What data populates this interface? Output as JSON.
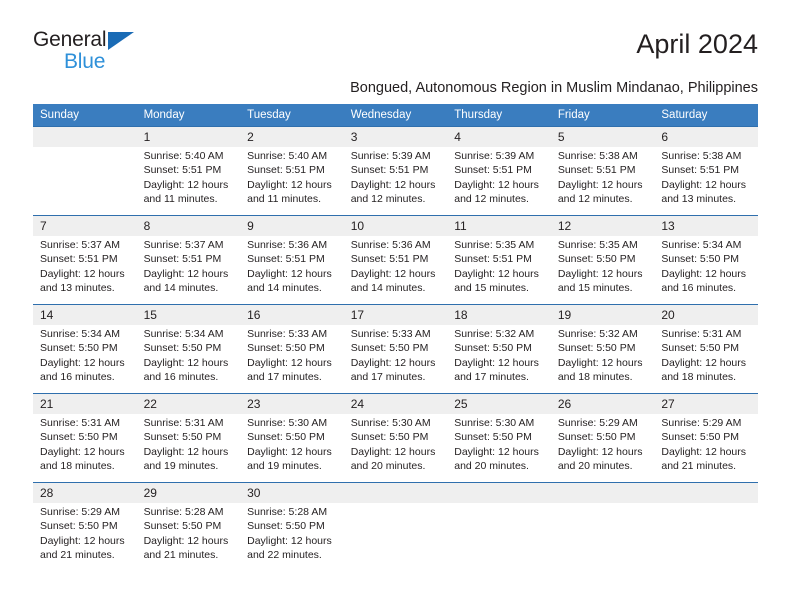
{
  "brand": {
    "name_part1": "General",
    "name_part2": "Blue",
    "triangle_color": "#1a6bb5",
    "blue_color": "#2e90d9"
  },
  "header": {
    "month_title": "April 2024",
    "location": "Bongued, Autonomous Region in Muslim Mindanao, Philippines"
  },
  "theme": {
    "header_bg": "#3a7dbf",
    "row_rule": "#2f6fad",
    "daynum_bg": "#efefef",
    "text": "#231f20"
  },
  "calendar": {
    "weekday_headers": [
      "Sunday",
      "Monday",
      "Tuesday",
      "Wednesday",
      "Thursday",
      "Friday",
      "Saturday"
    ],
    "weeks": [
      [
        {
          "day": "",
          "sunrise": "",
          "sunset": "",
          "daylight_line1": "",
          "daylight_line2": ""
        },
        {
          "day": "1",
          "sunrise": "Sunrise: 5:40 AM",
          "sunset": "Sunset: 5:51 PM",
          "daylight_line1": "Daylight: 12 hours",
          "daylight_line2": "and 11 minutes."
        },
        {
          "day": "2",
          "sunrise": "Sunrise: 5:40 AM",
          "sunset": "Sunset: 5:51 PM",
          "daylight_line1": "Daylight: 12 hours",
          "daylight_line2": "and 11 minutes."
        },
        {
          "day": "3",
          "sunrise": "Sunrise: 5:39 AM",
          "sunset": "Sunset: 5:51 PM",
          "daylight_line1": "Daylight: 12 hours",
          "daylight_line2": "and 12 minutes."
        },
        {
          "day": "4",
          "sunrise": "Sunrise: 5:39 AM",
          "sunset": "Sunset: 5:51 PM",
          "daylight_line1": "Daylight: 12 hours",
          "daylight_line2": "and 12 minutes."
        },
        {
          "day": "5",
          "sunrise": "Sunrise: 5:38 AM",
          "sunset": "Sunset: 5:51 PM",
          "daylight_line1": "Daylight: 12 hours",
          "daylight_line2": "and 12 minutes."
        },
        {
          "day": "6",
          "sunrise": "Sunrise: 5:38 AM",
          "sunset": "Sunset: 5:51 PM",
          "daylight_line1": "Daylight: 12 hours",
          "daylight_line2": "and 13 minutes."
        }
      ],
      [
        {
          "day": "7",
          "sunrise": "Sunrise: 5:37 AM",
          "sunset": "Sunset: 5:51 PM",
          "daylight_line1": "Daylight: 12 hours",
          "daylight_line2": "and 13 minutes."
        },
        {
          "day": "8",
          "sunrise": "Sunrise: 5:37 AM",
          "sunset": "Sunset: 5:51 PM",
          "daylight_line1": "Daylight: 12 hours",
          "daylight_line2": "and 14 minutes."
        },
        {
          "day": "9",
          "sunrise": "Sunrise: 5:36 AM",
          "sunset": "Sunset: 5:51 PM",
          "daylight_line1": "Daylight: 12 hours",
          "daylight_line2": "and 14 minutes."
        },
        {
          "day": "10",
          "sunrise": "Sunrise: 5:36 AM",
          "sunset": "Sunset: 5:51 PM",
          "daylight_line1": "Daylight: 12 hours",
          "daylight_line2": "and 14 minutes."
        },
        {
          "day": "11",
          "sunrise": "Sunrise: 5:35 AM",
          "sunset": "Sunset: 5:51 PM",
          "daylight_line1": "Daylight: 12 hours",
          "daylight_line2": "and 15 minutes."
        },
        {
          "day": "12",
          "sunrise": "Sunrise: 5:35 AM",
          "sunset": "Sunset: 5:50 PM",
          "daylight_line1": "Daylight: 12 hours",
          "daylight_line2": "and 15 minutes."
        },
        {
          "day": "13",
          "sunrise": "Sunrise: 5:34 AM",
          "sunset": "Sunset: 5:50 PM",
          "daylight_line1": "Daylight: 12 hours",
          "daylight_line2": "and 16 minutes."
        }
      ],
      [
        {
          "day": "14",
          "sunrise": "Sunrise: 5:34 AM",
          "sunset": "Sunset: 5:50 PM",
          "daylight_line1": "Daylight: 12 hours",
          "daylight_line2": "and 16 minutes."
        },
        {
          "day": "15",
          "sunrise": "Sunrise: 5:34 AM",
          "sunset": "Sunset: 5:50 PM",
          "daylight_line1": "Daylight: 12 hours",
          "daylight_line2": "and 16 minutes."
        },
        {
          "day": "16",
          "sunrise": "Sunrise: 5:33 AM",
          "sunset": "Sunset: 5:50 PM",
          "daylight_line1": "Daylight: 12 hours",
          "daylight_line2": "and 17 minutes."
        },
        {
          "day": "17",
          "sunrise": "Sunrise: 5:33 AM",
          "sunset": "Sunset: 5:50 PM",
          "daylight_line1": "Daylight: 12 hours",
          "daylight_line2": "and 17 minutes."
        },
        {
          "day": "18",
          "sunrise": "Sunrise: 5:32 AM",
          "sunset": "Sunset: 5:50 PM",
          "daylight_line1": "Daylight: 12 hours",
          "daylight_line2": "and 17 minutes."
        },
        {
          "day": "19",
          "sunrise": "Sunrise: 5:32 AM",
          "sunset": "Sunset: 5:50 PM",
          "daylight_line1": "Daylight: 12 hours",
          "daylight_line2": "and 18 minutes."
        },
        {
          "day": "20",
          "sunrise": "Sunrise: 5:31 AM",
          "sunset": "Sunset: 5:50 PM",
          "daylight_line1": "Daylight: 12 hours",
          "daylight_line2": "and 18 minutes."
        }
      ],
      [
        {
          "day": "21",
          "sunrise": "Sunrise: 5:31 AM",
          "sunset": "Sunset: 5:50 PM",
          "daylight_line1": "Daylight: 12 hours",
          "daylight_line2": "and 18 minutes."
        },
        {
          "day": "22",
          "sunrise": "Sunrise: 5:31 AM",
          "sunset": "Sunset: 5:50 PM",
          "daylight_line1": "Daylight: 12 hours",
          "daylight_line2": "and 19 minutes."
        },
        {
          "day": "23",
          "sunrise": "Sunrise: 5:30 AM",
          "sunset": "Sunset: 5:50 PM",
          "daylight_line1": "Daylight: 12 hours",
          "daylight_line2": "and 19 minutes."
        },
        {
          "day": "24",
          "sunrise": "Sunrise: 5:30 AM",
          "sunset": "Sunset: 5:50 PM",
          "daylight_line1": "Daylight: 12 hours",
          "daylight_line2": "and 20 minutes."
        },
        {
          "day": "25",
          "sunrise": "Sunrise: 5:30 AM",
          "sunset": "Sunset: 5:50 PM",
          "daylight_line1": "Daylight: 12 hours",
          "daylight_line2": "and 20 minutes."
        },
        {
          "day": "26",
          "sunrise": "Sunrise: 5:29 AM",
          "sunset": "Sunset: 5:50 PM",
          "daylight_line1": "Daylight: 12 hours",
          "daylight_line2": "and 20 minutes."
        },
        {
          "day": "27",
          "sunrise": "Sunrise: 5:29 AM",
          "sunset": "Sunset: 5:50 PM",
          "daylight_line1": "Daylight: 12 hours",
          "daylight_line2": "and 21 minutes."
        }
      ],
      [
        {
          "day": "28",
          "sunrise": "Sunrise: 5:29 AM",
          "sunset": "Sunset: 5:50 PM",
          "daylight_line1": "Daylight: 12 hours",
          "daylight_line2": "and 21 minutes."
        },
        {
          "day": "29",
          "sunrise": "Sunrise: 5:28 AM",
          "sunset": "Sunset: 5:50 PM",
          "daylight_line1": "Daylight: 12 hours",
          "daylight_line2": "and 21 minutes."
        },
        {
          "day": "30",
          "sunrise": "Sunrise: 5:28 AM",
          "sunset": "Sunset: 5:50 PM",
          "daylight_line1": "Daylight: 12 hours",
          "daylight_line2": "and 22 minutes."
        },
        {
          "day": "",
          "sunrise": "",
          "sunset": "",
          "daylight_line1": "",
          "daylight_line2": ""
        },
        {
          "day": "",
          "sunrise": "",
          "sunset": "",
          "daylight_line1": "",
          "daylight_line2": ""
        },
        {
          "day": "",
          "sunrise": "",
          "sunset": "",
          "daylight_line1": "",
          "daylight_line2": ""
        },
        {
          "day": "",
          "sunrise": "",
          "sunset": "",
          "daylight_line1": "",
          "daylight_line2": ""
        }
      ]
    ]
  }
}
